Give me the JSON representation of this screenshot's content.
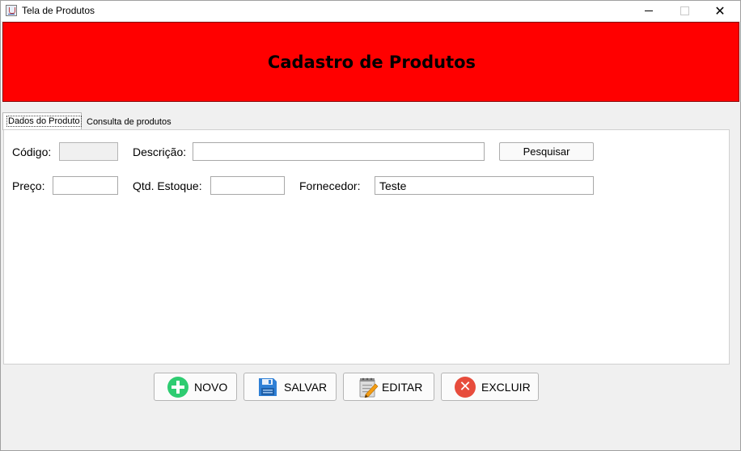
{
  "window": {
    "title": "Tela de Produtos",
    "minimize_glyph": "—",
    "maximize_glyph": "□",
    "close_glyph": "✕"
  },
  "header": {
    "title": "Cadastro de Produtos",
    "background": "#ff0000"
  },
  "tabs": [
    {
      "label": "Dados do Produto",
      "active": true
    },
    {
      "label": "Consulta de produtos",
      "active": false
    }
  ],
  "form": {
    "codigo_label": "Código:",
    "codigo_value": "",
    "descricao_label": "Descrição:",
    "descricao_value": "",
    "pesquisar_label": "Pesquisar",
    "preco_label": "Preço:",
    "preco_value": "",
    "estoque_label": "Qtd. Estoque:",
    "estoque_value": "",
    "fornecedor_label": "Fornecedor:",
    "fornecedor_value": "Teste"
  },
  "actions": {
    "novo_label": "NOVO",
    "salvar_label": "SALVAR",
    "editar_label": "EDITAR",
    "excluir_label": "EXCLUIR",
    "novo_icon": "plus-circle-icon",
    "salvar_icon": "floppy-disk-icon",
    "editar_icon": "notepad-pencil-icon",
    "excluir_icon": "close-circle-icon"
  }
}
